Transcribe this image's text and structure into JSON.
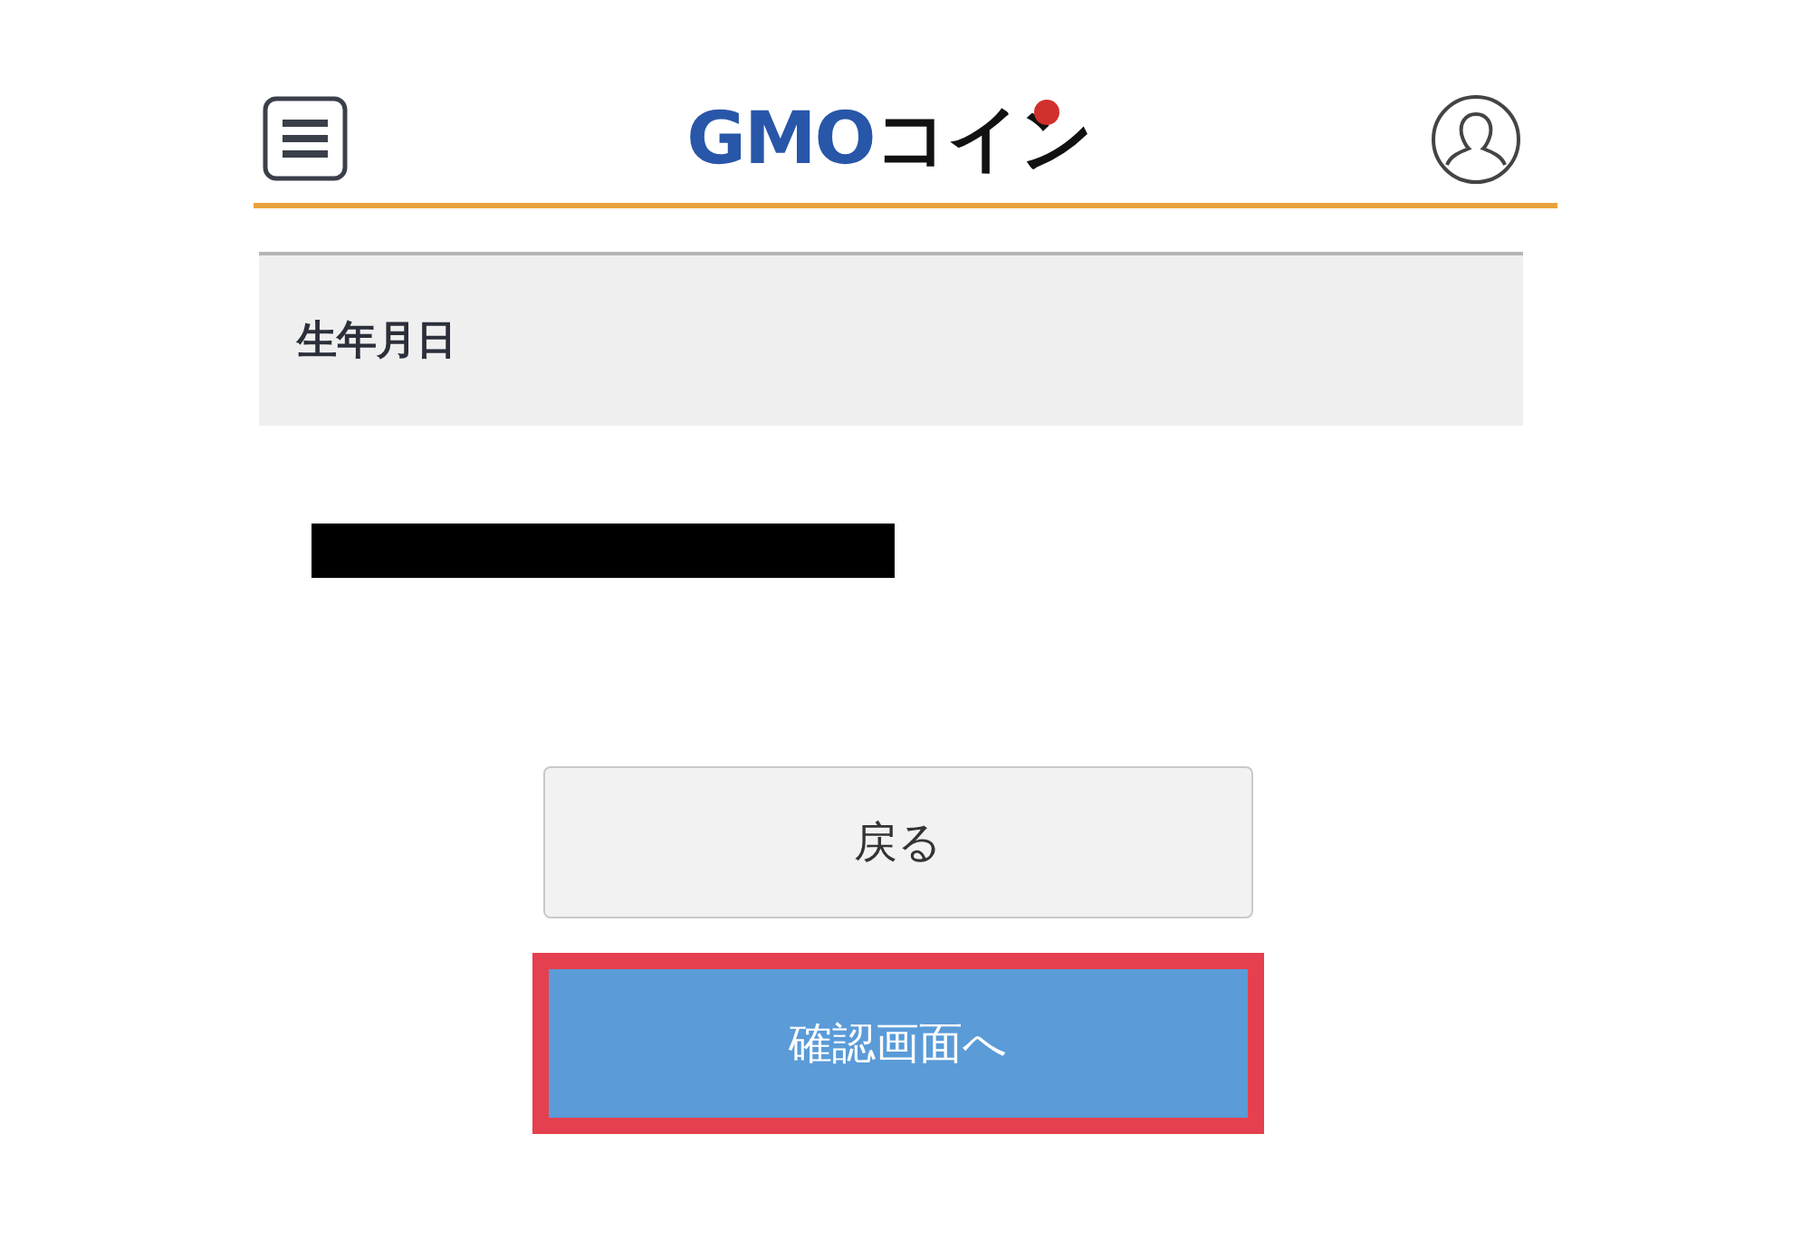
{
  "header": {
    "logo": {
      "brand": "GMO",
      "name": "コイン"
    }
  },
  "section": {
    "heading": "生年月日",
    "value_redacted": true
  },
  "buttons": [
    {
      "kind": "secondary",
      "label": "戻る",
      "highlighted": false
    },
    {
      "kind": "primary",
      "label": "確認画面へ",
      "highlighted": true
    }
  ]
}
